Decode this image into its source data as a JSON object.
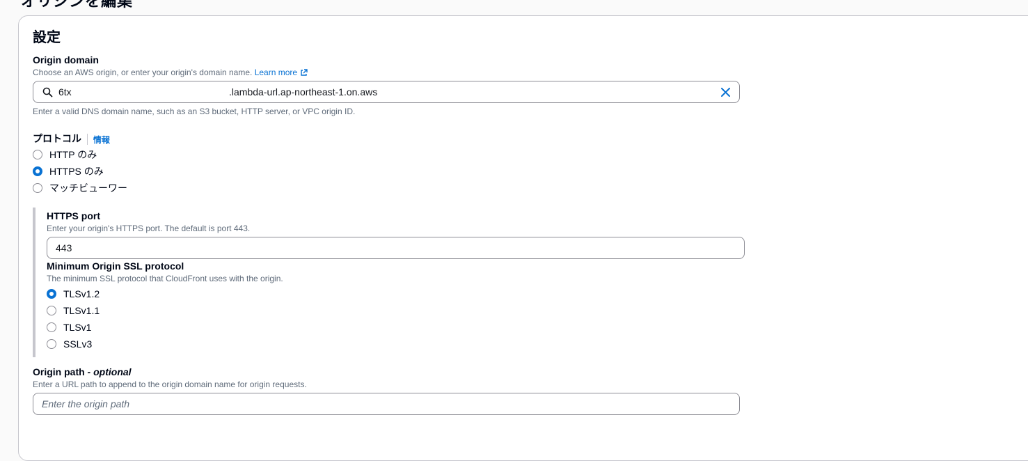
{
  "header": {
    "title_fragment": "オリジンを編集"
  },
  "settings": {
    "title": "設定",
    "origin_domain": {
      "label": "Origin domain",
      "description": "Choose an AWS origin, or enter your origin's domain name.",
      "learn_more": "Learn more",
      "value_prefix": "6tx",
      "value_suffix": ".lambda-url.ap-northeast-1.on.aws",
      "hint": "Enter a valid DNS domain name, such as an S3 bucket, HTTP server, or VPC origin ID."
    },
    "protocol": {
      "label": "プロトコル",
      "info": "情報",
      "options": [
        {
          "label": "HTTP のみ",
          "checked": false
        },
        {
          "label": "HTTPS のみ",
          "checked": true
        },
        {
          "label": "マッチビューワー",
          "checked": false
        }
      ]
    },
    "https_port": {
      "label": "HTTPS port",
      "description": "Enter your origin's HTTPS port. The default is port 443.",
      "value": "443"
    },
    "min_ssl": {
      "label": "Minimum Origin SSL protocol",
      "description": "The minimum SSL protocol that CloudFront uses with the origin.",
      "options": [
        {
          "label": "TLSv1.2",
          "checked": true
        },
        {
          "label": "TLSv1.1",
          "checked": false
        },
        {
          "label": "TLSv1",
          "checked": false
        },
        {
          "label": "SSLv3",
          "checked": false
        }
      ]
    },
    "origin_path": {
      "label": "Origin path",
      "label_suffix": " - optional",
      "description": "Enter a URL path to append to the origin domain name for origin requests.",
      "placeholder": "Enter the origin path"
    }
  },
  "colors": {
    "accent": "#0972d3",
    "text": "#000716",
    "muted": "#5f6b7a",
    "border": "#8c8c94"
  }
}
